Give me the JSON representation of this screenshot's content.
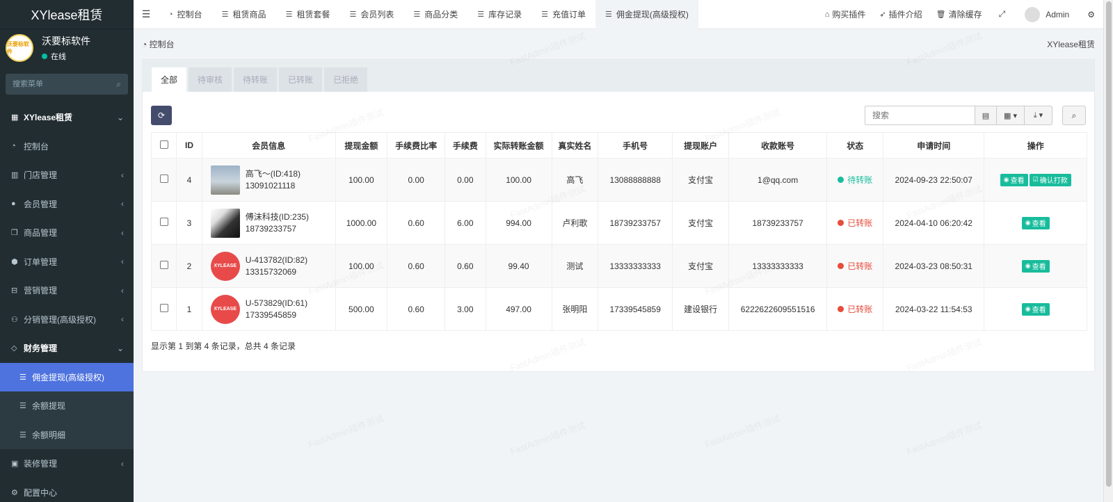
{
  "app": {
    "title": "XYlease租赁"
  },
  "user": {
    "name": "沃要标软件",
    "status": "在线",
    "avatar_text": "沃要标软件"
  },
  "sidebar": {
    "search_placeholder": "搜索菜单",
    "items": [
      {
        "label": "XYlease租赁",
        "icon": "grid-icon",
        "glyph": "▦",
        "type": "header",
        "arrow": "⌄"
      },
      {
        "label": "控制台",
        "icon": "dashboard-icon",
        "glyph": "◔",
        "type": "item",
        "arrow": ""
      },
      {
        "label": "门店管理",
        "icon": "columns-icon",
        "glyph": "▥",
        "type": "item",
        "arrow": "‹"
      },
      {
        "label": "会员管理",
        "icon": "user-circle-icon",
        "glyph": "●",
        "type": "item",
        "arrow": "‹"
      },
      {
        "label": "商品管理",
        "icon": "clone-icon",
        "glyph": "❐",
        "type": "item",
        "arrow": "‹"
      },
      {
        "label": "订单管理",
        "icon": "cube-icon",
        "glyph": "⬢",
        "type": "item",
        "arrow": "‹"
      },
      {
        "label": "营销管理",
        "icon": "hdd-icon",
        "glyph": "⊟",
        "type": "item",
        "arrow": "‹"
      },
      {
        "label": "分销管理(高级授权)",
        "icon": "sitemap-icon",
        "glyph": "⚇",
        "type": "item",
        "arrow": "‹"
      },
      {
        "label": "财务管理",
        "icon": "diamond-icon",
        "glyph": "◇",
        "type": "open",
        "arrow": "⌄"
      },
      {
        "label": "佣金提现(高级授权)",
        "icon": "list-icon",
        "glyph": "☰",
        "type": "active",
        "arrow": ""
      },
      {
        "label": "余额提现",
        "icon": "list-icon",
        "glyph": "☰",
        "type": "sub",
        "arrow": ""
      },
      {
        "label": "余额明细",
        "icon": "list-icon",
        "glyph": "☰",
        "type": "sub",
        "arrow": ""
      },
      {
        "label": "装修管理",
        "icon": "image-icon",
        "glyph": "▣",
        "type": "item",
        "arrow": "‹"
      },
      {
        "label": "配置中心",
        "icon": "cog-icon",
        "glyph": "⚙",
        "type": "item",
        "arrow": ""
      }
    ]
  },
  "navbar": {
    "tabs": [
      {
        "label": "控制台",
        "icon": "dashboard-icon",
        "glyph": "◔"
      },
      {
        "label": "租赁商品",
        "icon": "list-icon",
        "glyph": "☰"
      },
      {
        "label": "租赁套餐",
        "icon": "list-icon",
        "glyph": "☰"
      },
      {
        "label": "会员列表",
        "icon": "list-icon",
        "glyph": "☰"
      },
      {
        "label": "商品分类",
        "icon": "list-icon",
        "glyph": "☰"
      },
      {
        "label": "库存记录",
        "icon": "list-icon",
        "glyph": "☰"
      },
      {
        "label": "充值订单",
        "icon": "list-icon",
        "glyph": "☰"
      },
      {
        "label": "佣金提现(高级授权)",
        "icon": "list-icon",
        "glyph": "☰"
      }
    ],
    "right": [
      {
        "label": "购买插件",
        "icon": "home-icon",
        "glyph": "⌂"
      },
      {
        "label": "插件介绍",
        "icon": "rocket-icon",
        "glyph": "➶"
      },
      {
        "label": "清除缓存",
        "icon": "trash-icon",
        "glyph": "🗑"
      }
    ],
    "admin_name": "Admin"
  },
  "breadcrumb": {
    "current": "控制台",
    "right": "XYlease租赁"
  },
  "filter_tabs": [
    "全部",
    "待审核",
    "待转账",
    "已转账",
    "已拒绝"
  ],
  "search": {
    "placeholder": "搜索"
  },
  "table": {
    "headers": [
      "ID",
      "会员信息",
      "提现金额",
      "手续费比率",
      "手续费",
      "实际转账金额",
      "真实姓名",
      "手机号",
      "提现账户",
      "收款账号",
      "状态",
      "申请时间",
      "操作"
    ],
    "rows": [
      {
        "id": "4",
        "member": "高飞～(ID:418)",
        "member_phone": "13091021118",
        "avatar": "photo1",
        "amount": "100.00",
        "rate": "0.00",
        "fee": "0.00",
        "actual": "100.00",
        "name": "高飞",
        "phone": "13088888888",
        "account_type": "支付宝",
        "account": "1@qq.com",
        "status": "待转账",
        "status_kind": "pending",
        "time": "2024-09-23 22:50:07",
        "view_label": "查看",
        "confirm_label": "确认打款"
      },
      {
        "id": "3",
        "member": "傅沫科技(ID:235)",
        "member_phone": "18739233757",
        "avatar": "photo2",
        "amount": "1000.00",
        "rate": "0.60",
        "fee": "6.00",
        "actual": "994.00",
        "name": "卢利歌",
        "phone": "18739233757",
        "account_type": "支付宝",
        "account": "18739233757",
        "status": "已转账",
        "status_kind": "done",
        "time": "2024-04-10 06:20:42",
        "view_label": "查看",
        "confirm_label": ""
      },
      {
        "id": "2",
        "member": "U-413782(ID:82)",
        "member_phone": "13315732069",
        "avatar": "logo",
        "amount": "100.00",
        "rate": "0.60",
        "fee": "0.60",
        "actual": "99.40",
        "name": "测试",
        "phone": "13333333333",
        "account_type": "支付宝",
        "account": "13333333333",
        "status": "已转账",
        "status_kind": "done",
        "time": "2024-03-23 08:50:31",
        "view_label": "查看",
        "confirm_label": ""
      },
      {
        "id": "1",
        "member": "U-573829(ID:61)",
        "member_phone": "17339545859",
        "avatar": "logo",
        "amount": "500.00",
        "rate": "0.60",
        "fee": "3.00",
        "actual": "497.00",
        "name": "张明阳",
        "phone": "17339545859",
        "account_type": "建设银行",
        "account": "6222622609551516",
        "status": "已转账",
        "status_kind": "done",
        "time": "2024-03-22 11:54:53",
        "view_label": "查看",
        "confirm_label": ""
      }
    ]
  },
  "footer": {
    "summary": "显示第 1 到第 4 条记录，总共 4 条记录"
  },
  "avatar_logo_text": "XYLEASE",
  "watermark": "FastAdmin插件测试",
  "colors": {
    "accent": "#4e73df",
    "success": "#18bc9c",
    "danger": "#e74c3c",
    "sidebar": "#222d32"
  }
}
